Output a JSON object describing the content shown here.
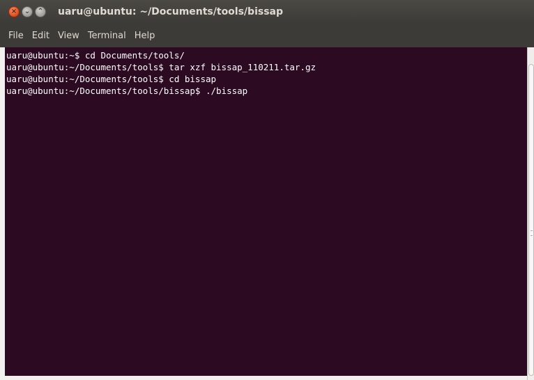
{
  "window": {
    "title": "uaru@ubuntu: ~/Documents/tools/bissap",
    "close_glyph": "×",
    "minimize_glyph": "⌄",
    "maximize_glyph": "⌃"
  },
  "menubar": {
    "items": [
      "File",
      "Edit",
      "View",
      "Terminal",
      "Help"
    ]
  },
  "terminal": {
    "lines": [
      "uaru@ubuntu:~$ cd Documents/tools/",
      "uaru@ubuntu:~/Documents/tools$ tar xzf bissap_110211.tar.gz",
      "uaru@ubuntu:~/Documents/tools$ cd bissap",
      "uaru@ubuntu:~/Documents/tools/bissap$ ./bissap"
    ]
  },
  "colors": {
    "terminal_bg": "#2c0a22",
    "titlebar_bg": "#3c3b37",
    "close_button": "#df4a16",
    "text": "#ffffff"
  },
  "icons": {
    "close": "close-icon",
    "minimize": "minimize-icon",
    "maximize": "maximize-icon"
  }
}
